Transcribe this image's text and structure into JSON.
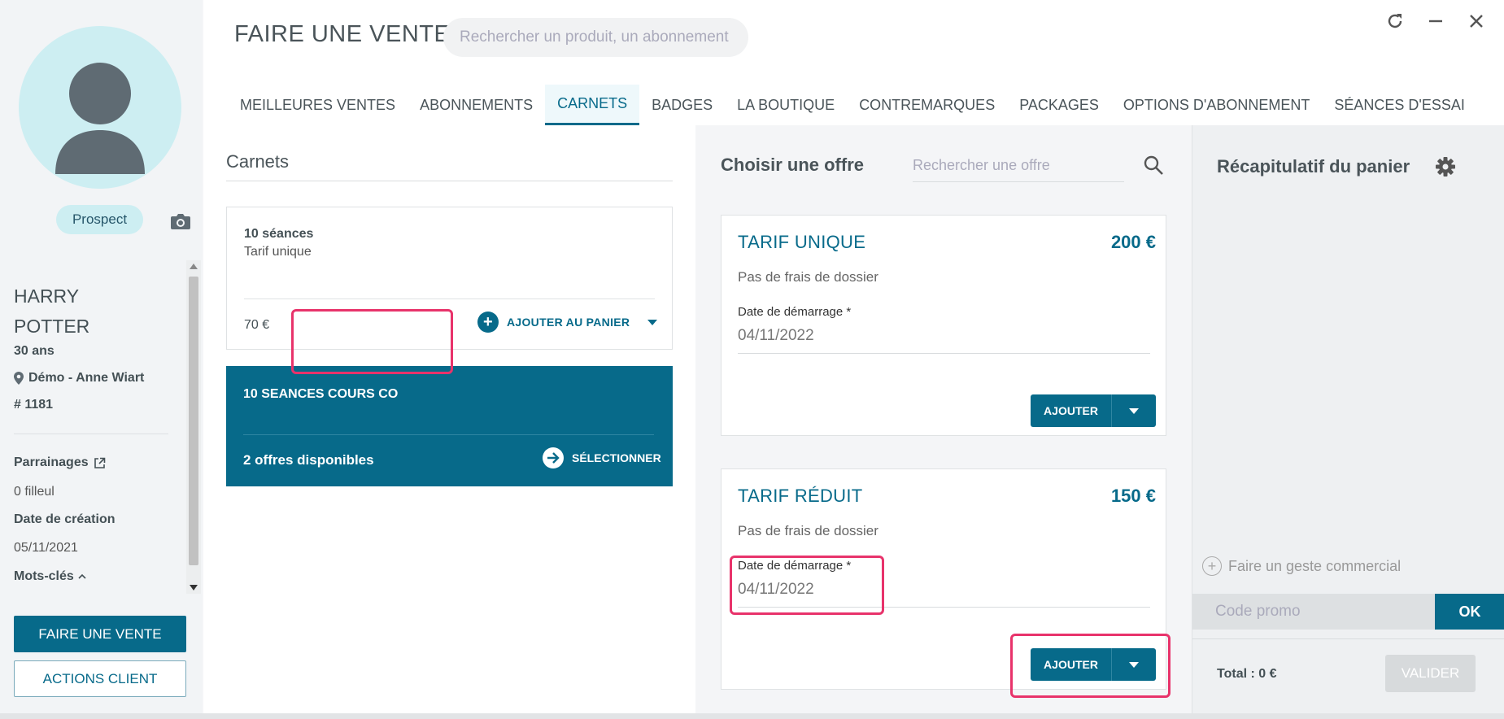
{
  "customer": {
    "status_badge": "Prospect",
    "first_name": "HARRY",
    "last_name": "POTTER",
    "age": "30 ans",
    "club": "Démo - Anne Wiart",
    "member_id": "# 1181",
    "parrainages_label": "Parrainages",
    "filleul": "0 filleul",
    "date_creation_label": "Date de création",
    "date_creation_value": "05/11/2021",
    "mots_cles_label": "Mots-clés",
    "faire_vente_button": "FAIRE UNE VENTE",
    "actions_client_button": "ACTIONS CLIENT"
  },
  "header": {
    "title": "FAIRE UNE VENTE",
    "search_placeholder": "Rechercher un produit, un abonnement"
  },
  "tabs": [
    {
      "label": "MEILLEURES VENTES",
      "active": false
    },
    {
      "label": "ABONNEMENTS",
      "active": false
    },
    {
      "label": "CARNETS",
      "active": true
    },
    {
      "label": "BADGES",
      "active": false
    },
    {
      "label": "LA BOUTIQUE",
      "active": false
    },
    {
      "label": "CONTREMARQUES",
      "active": false
    },
    {
      "label": "PACKAGES",
      "active": false
    },
    {
      "label": "OPTIONS D'ABONNEMENT",
      "active": false
    },
    {
      "label": "SÉANCES D'ESSAI",
      "active": false
    }
  ],
  "carnets": {
    "title": "Carnets",
    "items": [
      {
        "title": "10 séances",
        "subtitle": "Tarif unique",
        "price": "70 €",
        "add_label": "AJOUTER AU PANIER"
      },
      {
        "title": "10 SEANCES COURS CO",
        "available": "2 offres disponibles",
        "select_label": "SÉLECTIONNER"
      }
    ]
  },
  "offers": {
    "title": "Choisir une offre",
    "search_placeholder": "Rechercher une offre",
    "items": [
      {
        "name": "TARIF UNIQUE",
        "price": "200 €",
        "fee": "Pas de frais de dossier",
        "date_label": "Date de démarrage *",
        "date_value": "04/11/2022",
        "add_label": "AJOUTER"
      },
      {
        "name": "TARIF RÉDUIT",
        "price": "150 €",
        "fee": "Pas de frais de dossier",
        "date_label": "Date de démarrage *",
        "date_value": "04/11/2022",
        "add_label": "AJOUTER"
      }
    ]
  },
  "cart": {
    "title": "Récapitulatif du panier",
    "geste_label": "Faire un geste commercial",
    "promo_placeholder": "Code promo",
    "ok_label": "OK",
    "total": "Total : 0 €",
    "valider_label": "VALIDER"
  },
  "colors": {
    "primary": "#076a8a",
    "avatar_bg": "#cdeef2",
    "highlight": "#e8336b"
  }
}
